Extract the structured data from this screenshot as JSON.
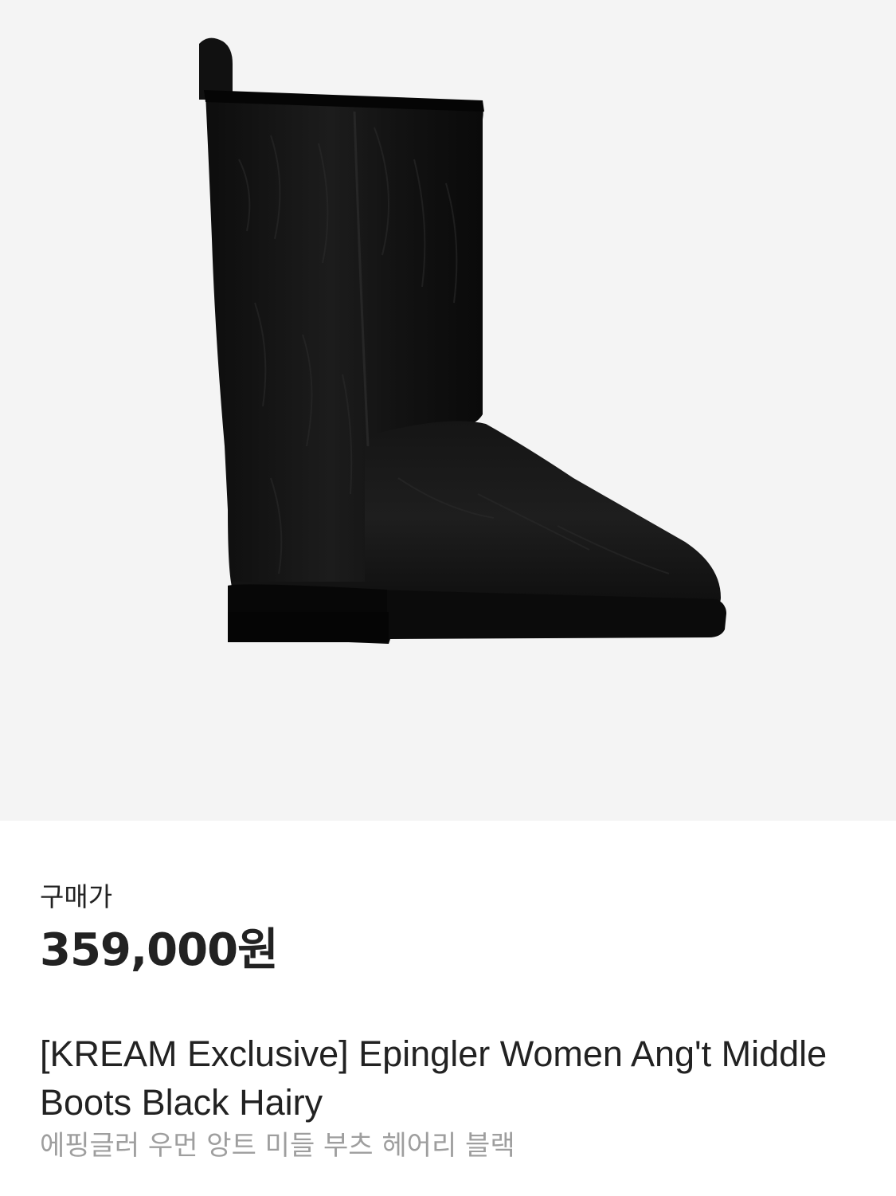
{
  "product": {
    "image_icon": "boot-image",
    "price_label": "구매가",
    "price": "359,000원",
    "title": "[KREAM Exclusive] Epingler Women Ang't Middle Boots Black Hairy",
    "subtitle": "에핑글러 우먼 앙트 미들 부츠 헤어리 블랙"
  },
  "colors": {
    "image_background": "#f4f4f4",
    "text_primary": "#222222",
    "text_secondary": "#9e9e9e",
    "boot": "#111111"
  }
}
